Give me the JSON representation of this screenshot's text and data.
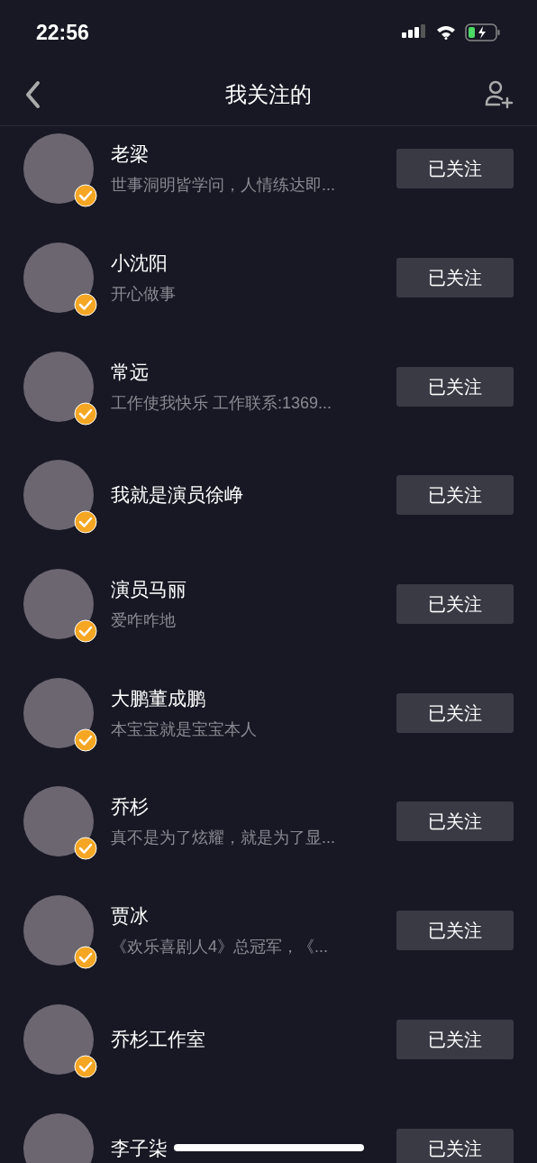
{
  "status_bar": {
    "time": "22:56"
  },
  "nav": {
    "title": "我关注的"
  },
  "users": [
    {
      "name": "老梁",
      "bio": "世事洞明皆学问，人情练达即...",
      "verified": true,
      "button": "已关注"
    },
    {
      "name": "小沈阳",
      "bio": "开心做事",
      "verified": true,
      "button": "已关注"
    },
    {
      "name": "常远",
      "bio": "工作使我快乐  工作联系:1369...",
      "verified": true,
      "button": "已关注"
    },
    {
      "name": "我就是演员徐峥",
      "verified": true,
      "button": "已关注"
    },
    {
      "name": "演员马丽",
      "bio": "爱咋咋地",
      "verified": true,
      "button": "已关注"
    },
    {
      "name": "大鹏董成鹏",
      "bio": "本宝宝就是宝宝本人",
      "verified": true,
      "button": "已关注"
    },
    {
      "name": "乔杉",
      "bio": "真不是为了炫耀，就是为了显...",
      "verified": true,
      "button": "已关注"
    },
    {
      "name": "贾冰",
      "bio": "《欢乐喜剧人4》总冠军，《...",
      "verified": true,
      "button": "已关注"
    },
    {
      "name": "乔杉工作室",
      "verified": true,
      "button": "已关注"
    },
    {
      "name": "李子柒",
      "button": "已关注"
    }
  ]
}
